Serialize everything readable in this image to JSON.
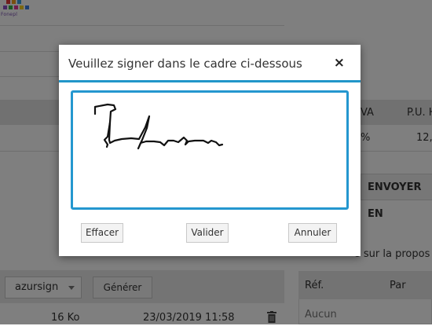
{
  "app": {
    "logo_caption": "Fonepl"
  },
  "background": {
    "table": {
      "col_tva": "VA",
      "col_pu": "P.U. H",
      "row_tva": "%",
      "row_pu": "12,"
    },
    "envoyer_button": "ENVOYER EN",
    "proposal_text": "s sur la propos",
    "signature_select": {
      "value": "azursign"
    },
    "generate_button": "Générer",
    "file_row": {
      "size": "16 Ko",
      "date": "23/03/2019 11:58"
    },
    "right_table": {
      "col_ref": "Réf.",
      "col_par": "Par",
      "empty": "Aucun"
    }
  },
  "modal": {
    "title": "Veuillez signer dans le cadre ci-dessous",
    "close_symbol": "×",
    "buttons": {
      "clear": "Effacer",
      "validate": "Valider",
      "cancel": "Annuler"
    },
    "signature_color": "#111111",
    "accent_color": "#2196c9"
  }
}
